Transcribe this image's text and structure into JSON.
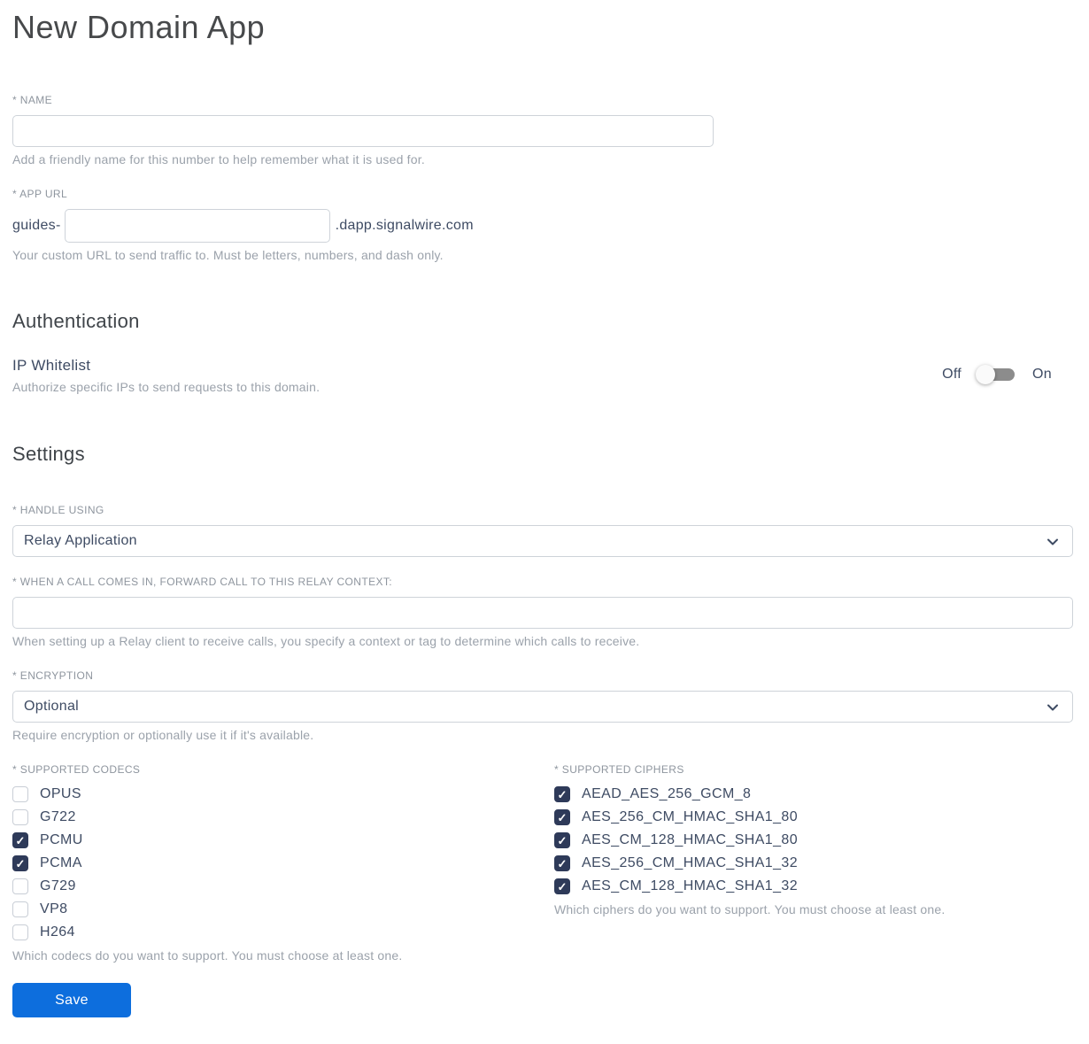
{
  "page": {
    "title": "New Domain App"
  },
  "fields": {
    "name": {
      "label": "* NAME",
      "value": "",
      "help": "Add a friendly name for this number to help remember what it is used for."
    },
    "app_url": {
      "label": "* APP URL",
      "prefix": "guides-",
      "value": "",
      "suffix": ".dapp.signalwire.com",
      "help": "Your custom URL to send traffic to. Must be letters, numbers, and dash only."
    }
  },
  "authentication": {
    "heading": "Authentication",
    "ip_whitelist": {
      "label": "IP Whitelist",
      "help": "Authorize specific IPs to send requests to this domain.",
      "off_label": "Off",
      "on_label": "On",
      "state": "off"
    }
  },
  "settings": {
    "heading": "Settings",
    "handle_using": {
      "label": "* HANDLE USING",
      "value": "Relay Application"
    },
    "relay_context": {
      "label": "* WHEN A CALL COMES IN, FORWARD CALL TO THIS RELAY CONTEXT:",
      "value": "",
      "help": "When setting up a Relay client to receive calls, you specify a context or tag to determine which calls to receive."
    },
    "encryption": {
      "label": "* ENCRYPTION",
      "value": "Optional",
      "help": "Require encryption or optionally use it if it's available."
    },
    "codecs": {
      "label": "* SUPPORTED CODECS",
      "items": [
        {
          "label": "OPUS",
          "checked": false
        },
        {
          "label": "G722",
          "checked": false
        },
        {
          "label": "PCMU",
          "checked": true
        },
        {
          "label": "PCMA",
          "checked": true
        },
        {
          "label": "G729",
          "checked": false
        },
        {
          "label": "VP8",
          "checked": false
        },
        {
          "label": "H264",
          "checked": false
        }
      ],
      "help": "Which codecs do you want to support. You must choose at least one."
    },
    "ciphers": {
      "label": "* SUPPORTED CIPHERS",
      "items": [
        {
          "label": "AEAD_AES_256_GCM_8",
          "checked": true
        },
        {
          "label": "AES_256_CM_HMAC_SHA1_80",
          "checked": true
        },
        {
          "label": "AES_CM_128_HMAC_SHA1_80",
          "checked": true
        },
        {
          "label": "AES_256_CM_HMAC_SHA1_32",
          "checked": true
        },
        {
          "label": "AES_CM_128_HMAC_SHA1_32",
          "checked": true
        }
      ],
      "help": "Which ciphers do you want to support. You must choose at least one."
    }
  },
  "actions": {
    "save_label": "Save"
  },
  "colors": {
    "primary_button": "#0d6edd",
    "checkbox_checked": "#2e3a59",
    "dark_text": "#3e4b63",
    "label_gray": "#8e959e",
    "help_gray": "#9ba2ab",
    "input_border": "#ced3d9",
    "toggle_track": "#8c8c8c"
  }
}
